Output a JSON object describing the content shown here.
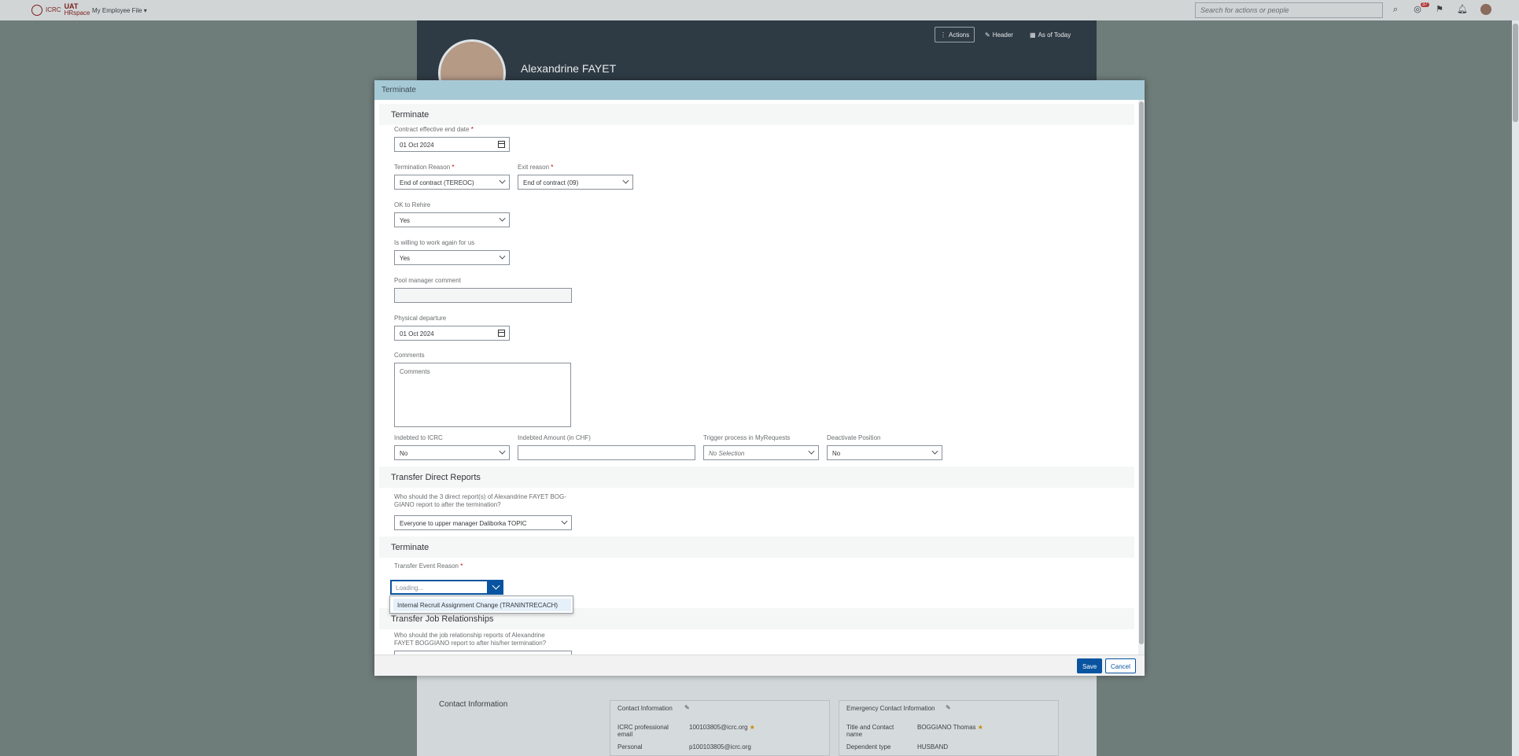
{
  "topbar": {
    "logo_line1": "ICRC",
    "logo_line2": "HRspace",
    "logo_tag": "UAT",
    "app_menu": "My Employee File ▾",
    "search_placeholder": "Search for actions or people",
    "notification_count": "37"
  },
  "background": {
    "employee_name": "Alexandrine FAYET",
    "actions_label": "Actions",
    "header_label": "Header",
    "as_of_label": "As of Today",
    "contact_section": "Contact Information",
    "contact_card_title": "Contact Information",
    "emergency_card_title": "Emergency Contact Information",
    "icrc_email_label": "ICRC professional email",
    "icrc_email_value": "100103805@icrc.org",
    "personal_label": "Personal",
    "personal_value": "p100103805@icrc.org",
    "title_contact_label": "Title and Contact name",
    "title_contact_value": "BOGGIANO Thomas",
    "dependent_type_label": "Dependent type",
    "dependent_type_value": "HUSBAND"
  },
  "dialog": {
    "title": "Terminate",
    "section_terminate": "Terminate",
    "contract_end_label": "Contract effective end date",
    "contract_end_value": "01 Oct 2024",
    "termination_reason_label": "Termination Reason",
    "termination_reason_value": "End of contract (TEREOC)",
    "exit_reason_label": "Exit reason",
    "exit_reason_value": "End of contract (09)",
    "ok_rehire_label": "OK to Rehire",
    "ok_rehire_value": "Yes",
    "willing_label": "Is willing to work again for us",
    "willing_value": "Yes",
    "pool_comment_label": "Pool manager comment",
    "pool_comment_value": "",
    "physical_departure_label": "Physical departure",
    "physical_departure_value": "01 Oct 2024",
    "comments_label": "Comments",
    "comments_placeholder": "Comments",
    "indebted_label": "Indebted to ICRC",
    "indebted_value": "No",
    "indebted_amount_label": "Indebted Amount (in CHF)",
    "indebted_amount_value": "",
    "trigger_label": "Trigger process in MyRequests",
    "trigger_value": "No Selection",
    "deactivate_label": "Deactivate Position",
    "deactivate_value": "No",
    "section_direct_reports": "Transfer Direct Reports",
    "direct_reports_question_1": "Who should the 3 direct report(s) of Alexandrine FAYET BOG-",
    "direct_reports_question_2": "GIANO report to after the termination?",
    "direct_reports_value": "Everyone to upper manager Daliborka TOPIC",
    "section_terminate_2": "Terminate",
    "transfer_event_label": "Transfer Event Reason",
    "transfer_event_placeholder": "Loading...",
    "dropdown_option": "Internal Recruit Assignment Change (TRANINTRECACH)",
    "section_job_relationships": "Transfer Job Relationships",
    "job_rel_question_1": "Who should the job relationship reports of Alexandrine",
    "job_rel_question_2": "FAYET BOGGIANO report to after his/her termination?",
    "save_label": "Save",
    "cancel_label": "Cancel",
    "required_mark": "*"
  }
}
